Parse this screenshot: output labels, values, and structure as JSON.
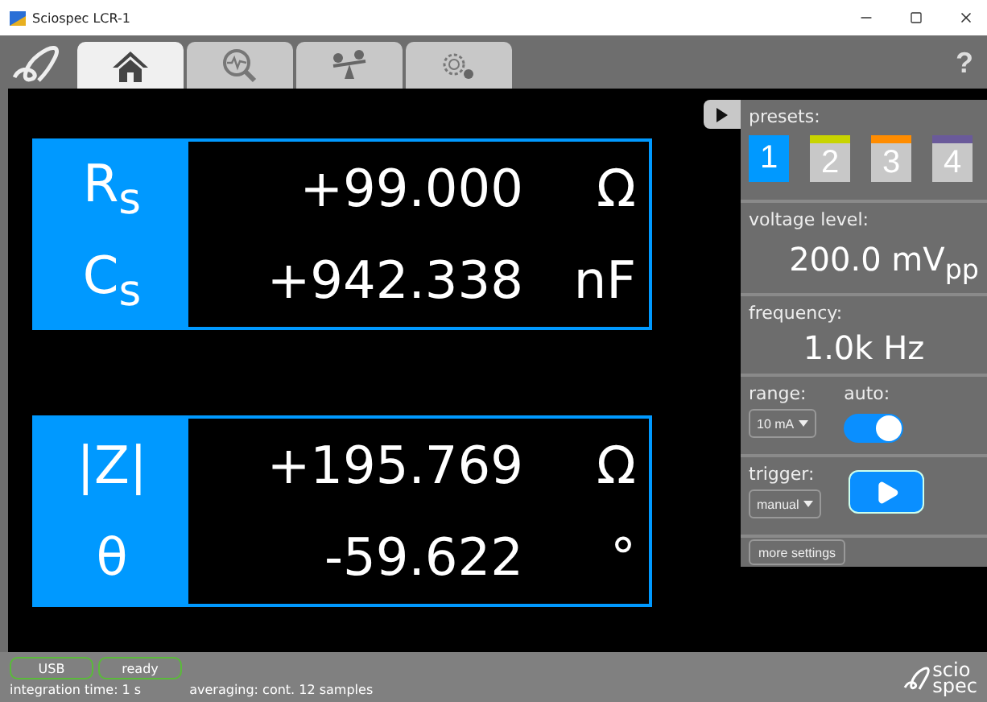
{
  "window": {
    "title": "Sciospec LCR-1"
  },
  "tabs": [
    {
      "kind": "home",
      "selected": true
    },
    {
      "kind": "analysis",
      "selected": false
    },
    {
      "kind": "balance",
      "selected": false
    },
    {
      "kind": "settings",
      "selected": false
    }
  ],
  "help_button": "?",
  "measurements": [
    {
      "rows": [
        {
          "symbol": "R$_{s}$",
          "value": "+99.000",
          "unit": "Ω"
        },
        {
          "symbol": "C$_{s}$",
          "value": "+942.338",
          "unit": "nF"
        }
      ]
    },
    {
      "rows": [
        {
          "symbol": "|Z|",
          "value": "+195.769",
          "unit": "Ω"
        },
        {
          "symbol": "θ",
          "value": "-59.622",
          "unit": "°"
        }
      ]
    }
  ],
  "panel": {
    "presets_label": "presets:",
    "presets": [
      {
        "label": "1",
        "selected": true
      },
      {
        "label": "2",
        "selected": false,
        "color": "#c8d400"
      },
      {
        "label": "3",
        "selected": false,
        "color": "#ff8c00"
      },
      {
        "label": "4",
        "selected": false,
        "color": "#6a5a9a"
      }
    ],
    "voltage_label": "voltage level:",
    "voltage_value": "200.0 mV$_{pp}$",
    "frequency_label": "frequency:",
    "frequency_value": "1.0k Hz",
    "range_label": "range:",
    "range_value": "10 mA",
    "auto_label": "auto:",
    "auto_on": true,
    "trigger_label": "trigger:",
    "trigger_value": "manual",
    "more_settings": "more settings"
  },
  "status_bar": {
    "badges": [
      "USB",
      "ready"
    ],
    "integration": "integration time: 1 s",
    "averaging": "averaging: cont. 12 samples",
    "logo_lines": [
      "scio",
      "spec"
    ]
  }
}
